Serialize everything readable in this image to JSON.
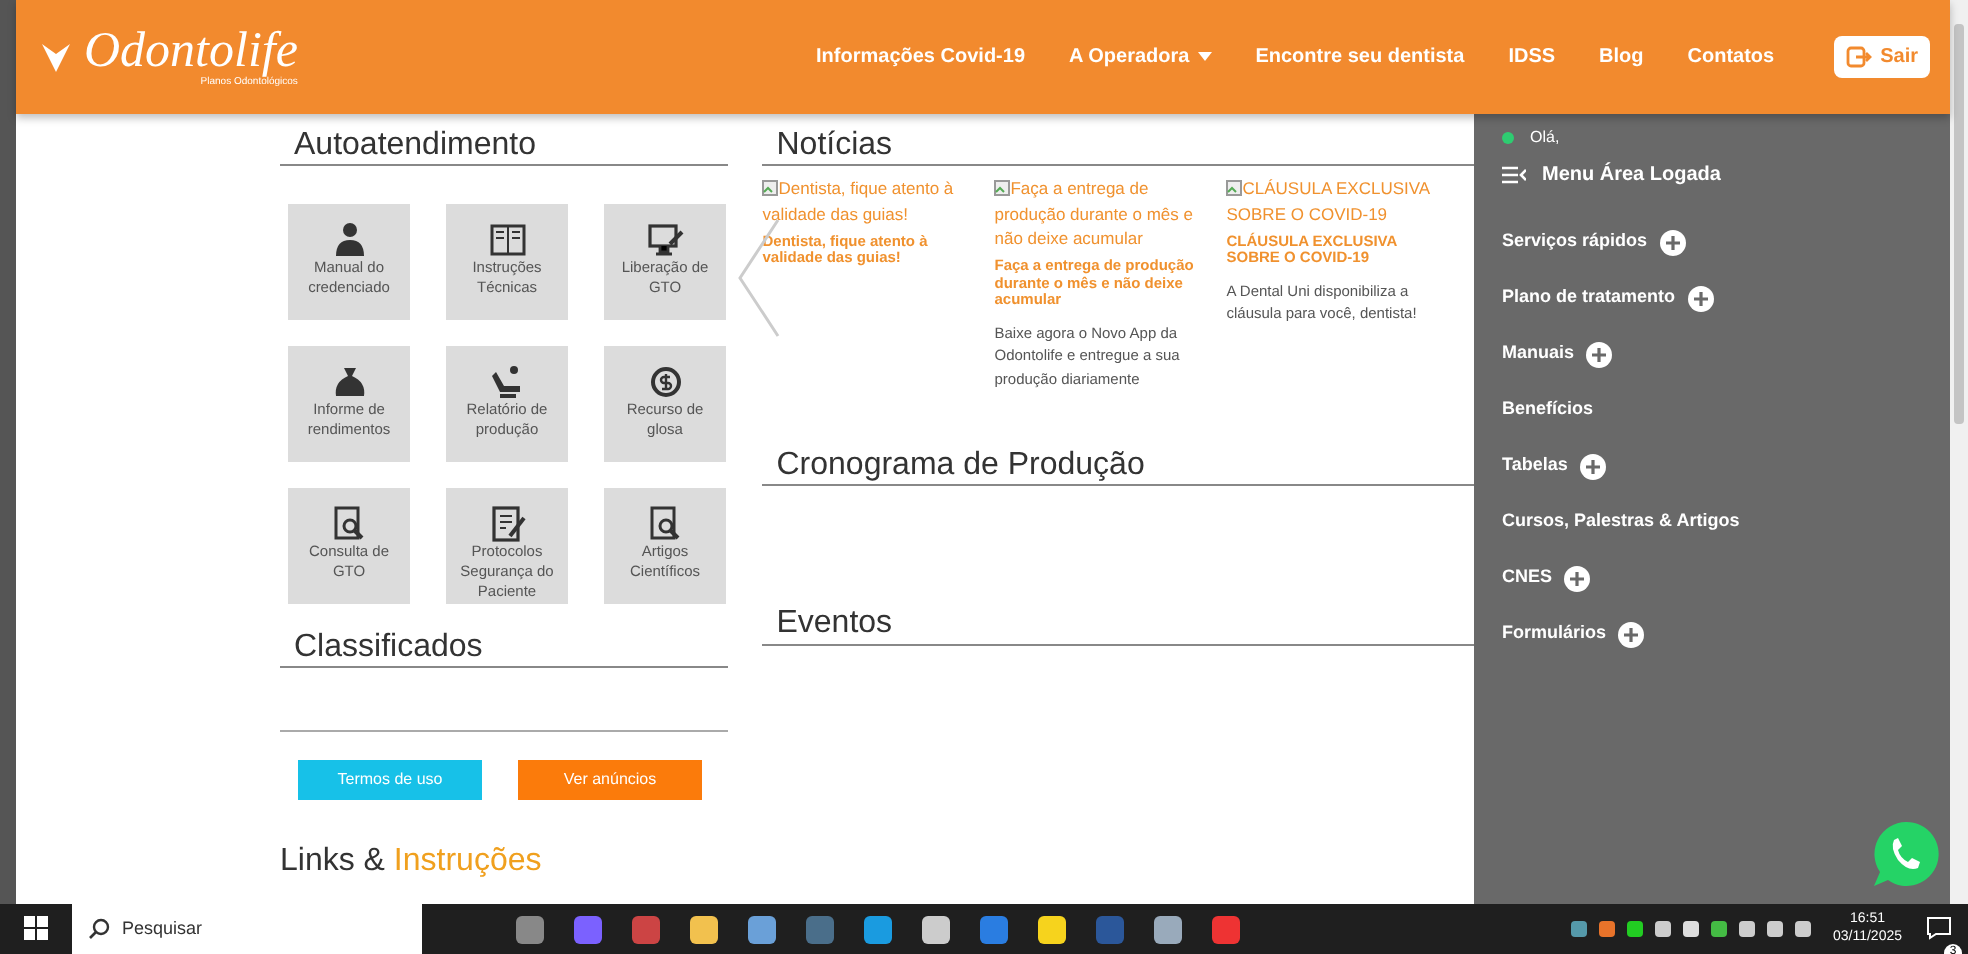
{
  "header": {
    "logo": "Odontolife",
    "tagline": "Planos Odontológicos",
    "nav": [
      {
        "label": "Informações Covid-19",
        "dropdown": false
      },
      {
        "label": "A Operadora",
        "dropdown": true
      },
      {
        "label": "Encontre seu dentista",
        "dropdown": false
      },
      {
        "label": "IDSS",
        "dropdown": false
      },
      {
        "label": "Blog",
        "dropdown": false
      },
      {
        "label": "Contatos",
        "dropdown": false
      }
    ],
    "logout": "Sair"
  },
  "autoatendimento": {
    "title": "Autoatendimento",
    "tiles": [
      {
        "label": "Manual do credenciado"
      },
      {
        "label": "Instruções Técnicas"
      },
      {
        "label": "Liberação de GTO"
      },
      {
        "label": "Informe de rendimentos"
      },
      {
        "label": "Relatório de produção"
      },
      {
        "label": "Recurso de glosa"
      },
      {
        "label": "Consulta de GTO"
      },
      {
        "label": "Protocolos Segurança do Paciente"
      },
      {
        "label": "Artigos Científicos"
      }
    ]
  },
  "classificados": {
    "title": "Classificados",
    "buttons": [
      {
        "label": "Termos de uso",
        "kind": "info"
      },
      {
        "label": "Ver anúncios",
        "kind": "warning"
      }
    ]
  },
  "noticias": {
    "title": "Notícias",
    "items": [
      {
        "alt": "Dentista, fique atento à validade das guias!",
        "title": "Dentista, fique atento à validade das guias!"
      },
      {
        "alt": "Faça a entrega de produção durante o mês e não deixe acumular",
        "title": "Faça a entrega de produção durante o mês e não deixe acumular",
        "text": "Baixe agora o Novo App da Odontolife e entregue a sua produção diariamente"
      },
      {
        "alt": "CLÁUSULA EXCLUSIVA SOBRE O COVID-19",
        "title": "CLÁUSULA EXCLUSIVA SOBRE O COVID-19",
        "text": "A Dental Uni disponibiliza a cláusula para você, dentista!"
      }
    ]
  },
  "cronograma": {
    "title": "Cronograma de Produção"
  },
  "eventos": {
    "title": "Eventos"
  },
  "links": {
    "title": "Links & ",
    "highlight": "Instruções"
  },
  "sidebar": {
    "greeting": "Olá,",
    "online": true,
    "menu_title": "Menu Área Logada",
    "items": [
      {
        "label": "Serviços rápidos",
        "expandable": true
      },
      {
        "label": "Plano de tratamento",
        "expandable": true
      },
      {
        "label": "Manuais",
        "expandable": true
      },
      {
        "label": "Benefícios",
        "expandable": false
      },
      {
        "label": "Tabelas",
        "expandable": true
      },
      {
        "label": "Cursos, Palestras & Artigos",
        "expandable": false
      },
      {
        "label": "CNES",
        "expandable": true
      },
      {
        "label": "Formulários",
        "expandable": true
      }
    ]
  },
  "taskbar": {
    "search_placeholder": "Pesquisar",
    "time": "16:51",
    "date": "03/11/2025",
    "notifications": "3"
  }
}
